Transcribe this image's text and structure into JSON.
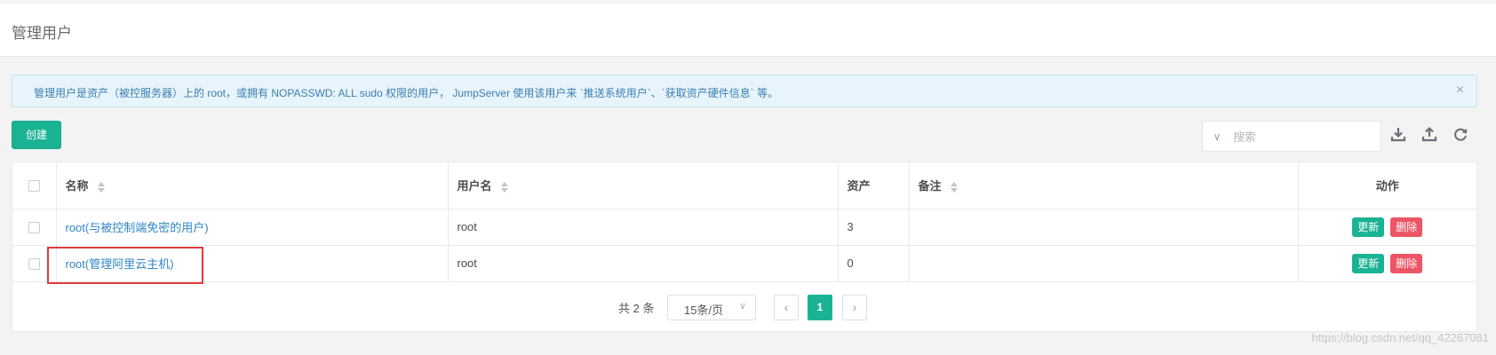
{
  "header": {
    "title": "管理用户"
  },
  "alert": {
    "text": "管理用户是资产（被控服务器）上的 root，或拥有 NOPASSWD: ALL sudo 权限的用户， JumpServer 使用该用户来 `推送系统用户`、`获取资产硬件信息` 等。",
    "close_glyph": "×"
  },
  "toolbar": {
    "create_label": "创建",
    "search_placeholder": "搜索",
    "search_value": "",
    "chevron_glyph": "∨"
  },
  "table": {
    "columns": [
      "名称",
      "用户名",
      "资产",
      "备注",
      "动作"
    ],
    "rows": [
      {
        "name": "root(与被控制端免密的用户)",
        "username": "root",
        "assets": "3",
        "comment": "",
        "update_label": "更新",
        "delete_label": "删除"
      },
      {
        "name": "root(管理阿里云主机)",
        "username": "root",
        "assets": "0",
        "comment": "",
        "update_label": "更新",
        "delete_label": "删除"
      }
    ]
  },
  "pagination": {
    "total_text": "共 2 条",
    "page_size": "15条/页",
    "page_size_arrow": "∨",
    "prev_glyph": "‹",
    "current_page": "1",
    "next_glyph": "›"
  },
  "watermark": "https://blog.csdn.net/qq_42267081",
  "colors": {
    "primary": "#1ab394",
    "danger": "#ed5565",
    "link": "#2f86c6",
    "alert_bg": "#e8f4fb",
    "highlight": "#e23b3b"
  }
}
